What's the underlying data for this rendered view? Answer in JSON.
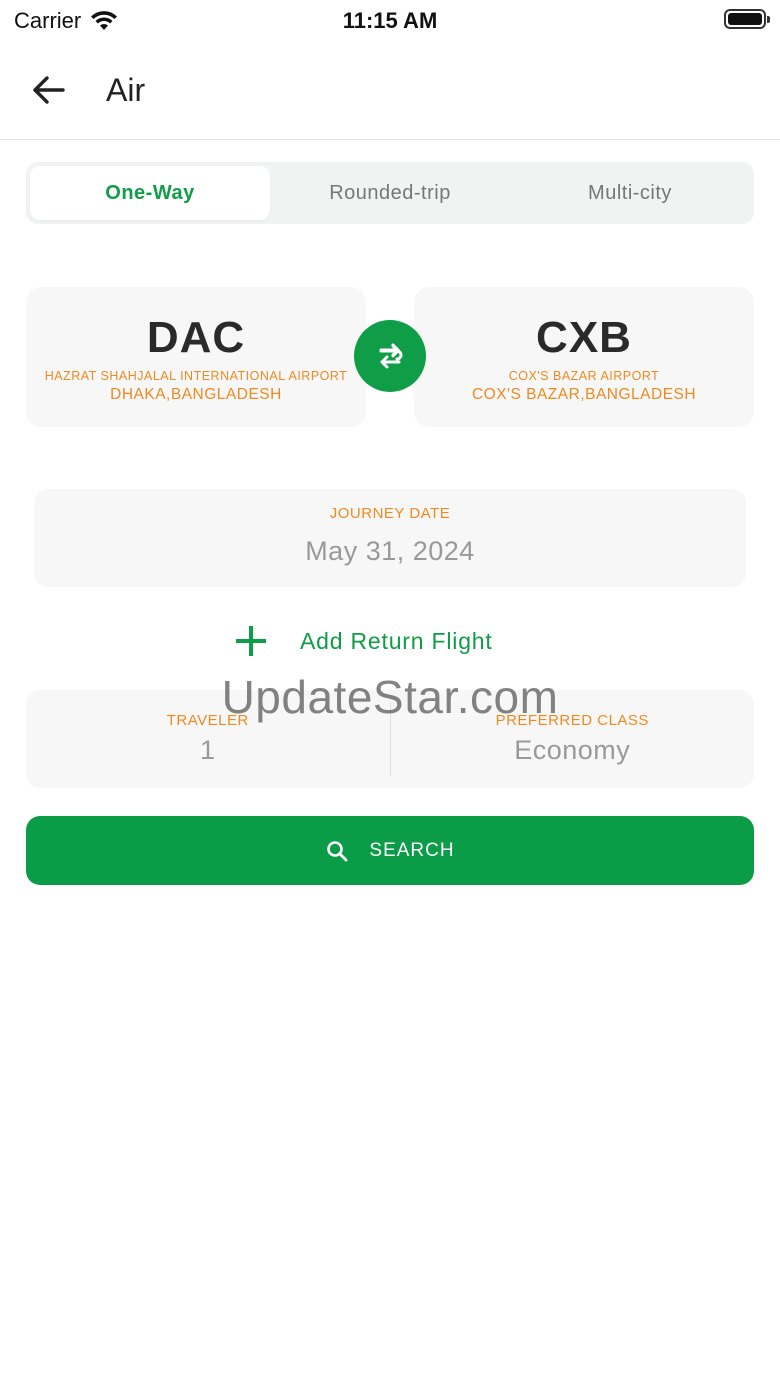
{
  "status_bar": {
    "carrier": "Carrier",
    "time": "11:15 AM"
  },
  "app_bar": {
    "title": "Air",
    "back_icon": "arrow-left-icon"
  },
  "trip_tabs": [
    {
      "label": "One-Way",
      "active": true
    },
    {
      "label": "Rounded-trip",
      "active": false
    },
    {
      "label": "Multi-city",
      "active": false
    }
  ],
  "from": {
    "code": "DAC",
    "airport": "HAZRAT SHAHJALAL INTERNATIONAL AIRPORT",
    "city": "DHAKA,BANGLADESH"
  },
  "to": {
    "code": "CXB",
    "airport": "COX'S BAZAR AIRPORT",
    "city": "COX'S BAZAR,BANGLADESH"
  },
  "swap_icon": "swap-arrows-icon",
  "journey": {
    "label": "JOURNEY DATE",
    "value": "May 31, 2024"
  },
  "add_return": {
    "label": "Add Return Flight",
    "icon": "plus-icon"
  },
  "traveler": {
    "label": "TRAVELER",
    "value": "1"
  },
  "preferred_class": {
    "label": "PREFERRED CLASS",
    "value": "Economy"
  },
  "search": {
    "label": "SEARCH",
    "icon": "search-icon"
  },
  "watermark": "UpdateStar.com",
  "colors": {
    "primary_green": "#0f9d47",
    "accent_orange": "#f0891f",
    "card_bg": "#f7f7f7"
  }
}
